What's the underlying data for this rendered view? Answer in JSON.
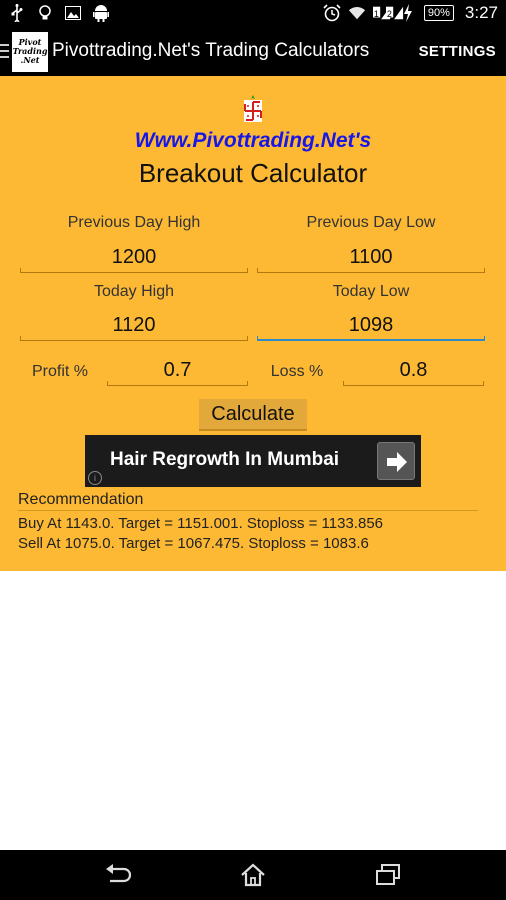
{
  "status_bar": {
    "battery": "90%",
    "time": "3:27",
    "sim1": "1",
    "sim2": "2",
    "icons_left": [
      "usb-icon",
      "lightbulb-icon",
      "image-icon",
      "android-icon"
    ],
    "icons_right": [
      "alarm-icon",
      "wifi-icon",
      "signal-icon",
      "signal-icon",
      "charging-icon"
    ]
  },
  "action_bar": {
    "logo_line1": "Pivot",
    "logo_line2": "Trading",
    "logo_line3": ".Net",
    "title": "Pivottrading.Net's Trading Calculators",
    "settings_label": "SETTINGS"
  },
  "main": {
    "site_title": "Www.Pivottrading.Net's",
    "calc_title": "Breakout Calculator",
    "fields": {
      "prev_high_label": "Previous Day High",
      "prev_high_value": "1200",
      "prev_low_label": "Previous Day Low",
      "prev_low_value": "1100",
      "today_high_label": "Today High",
      "today_high_value": "1120",
      "today_low_label": "Today Low",
      "today_low_value": "1098",
      "profit_label": "Profit %",
      "profit_value": "0.7",
      "loss_label": "Loss %",
      "loss_value": "0.8"
    },
    "calculate_label": "Calculate",
    "ad": {
      "text": "Hair Regrowth In Mumbai",
      "info": "i"
    },
    "recommendation": {
      "header": "Recommendation",
      "buy": "Buy At 1143.0. Target = 1151.001. Stoploss = 1133.856",
      "sell": "Sell At 1075.0. Target = 1067.475. Stoploss = 1083.6"
    }
  },
  "colors": {
    "panel": "#fdb933",
    "site_title": "#1717e8",
    "focus": "#2d89c8"
  },
  "nav_bar": {
    "icons": [
      "back-icon",
      "home-icon",
      "recent-apps-icon"
    ]
  }
}
